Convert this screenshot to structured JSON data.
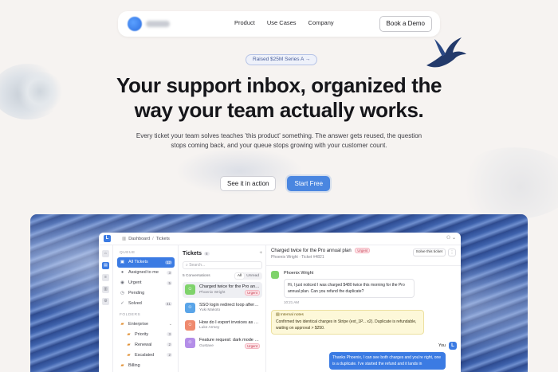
{
  "nav": {
    "links": [
      "Product",
      "Use Cases",
      "Company"
    ],
    "cta": "Book a Demo"
  },
  "hero": {
    "badge": "Raised $25M Series A →",
    "title_line1": "Your support inbox, organized the",
    "title_line2": "way your team actually works.",
    "subtitle": "Every ticket your team solves teaches 'this product' something. The answer gets reused, the question stops coming back, and your queue stops growing with your customer count.",
    "cta_secondary": "See it in action",
    "cta_primary": "Start Free",
    "accent_color": "#4a86e0"
  },
  "app": {
    "breadcrumb": [
      "Dashboard",
      "Tickets"
    ],
    "queues_heading": "QUEUE",
    "queues": [
      {
        "label": "All Tickets",
        "count": "12",
        "icon": "inbox-icon"
      },
      {
        "label": "Assigned to me",
        "count": "3",
        "icon": "person-icon"
      },
      {
        "label": "Urgent",
        "count": "5",
        "icon": "alert-icon"
      },
      {
        "label": "Pending",
        "count": "",
        "icon": "clock-icon"
      },
      {
        "label": "Solved",
        "count": "41",
        "icon": "check-icon"
      }
    ],
    "folders_heading": "FOLDERS",
    "folders": {
      "group": "Enterprise",
      "items": [
        {
          "label": "Priority",
          "count": "3"
        },
        {
          "label": "Renewal",
          "count": "2"
        },
        {
          "label": "Escalated",
          "count": "2"
        }
      ],
      "next": "Billing"
    },
    "tickets": {
      "title": "Tickets",
      "count": "8",
      "search_placeholder": "Search...",
      "summary": "5 Conversations",
      "filters": [
        "All",
        "Unread"
      ],
      "items": [
        {
          "subject": "Charged twice for the Pro annu...",
          "name": "Phoenix Wright",
          "urgent": "Urgent",
          "color": "#7fd36b"
        },
        {
          "subject": "SSO login redirect loop after S...",
          "name": "Yuki Makoto",
          "urgent": "",
          "color": "#5aa5e8"
        },
        {
          "subject": "How do I export invoices as CS...",
          "name": "Luke Armey",
          "urgent": "",
          "color": "#ef8a6e"
        },
        {
          "subject": "Feature request: dark mode fo...",
          "name": "Gustave",
          "urgent": "Urgent",
          "color": "#b48ee8"
        }
      ]
    },
    "conversation": {
      "title": "Charged twice for the Pro annual plan",
      "urgent": "Urgent",
      "meta": "Phoenix Wright · Ticket #4821",
      "solve_label": "Solve this ticket",
      "more_label": "⋮",
      "customer_name": "Phoenix Wright",
      "customer_message": "Hi, I just noticed I was charged $480 twice this morning for the Pro annual plan. Can you refund the duplicate?",
      "customer_time": "10:21 AM",
      "note_heading": "Internal notes",
      "note_text": "Confirmed two identical charges in Stripe (ext_1P... x2). Duplicate is refundable, waiting on approval > $250.",
      "you_label": "You",
      "reply": "Thanks Phoenix, I can see both charges and you're right, one is a duplicate. I've started the refund and it lands in"
    }
  }
}
